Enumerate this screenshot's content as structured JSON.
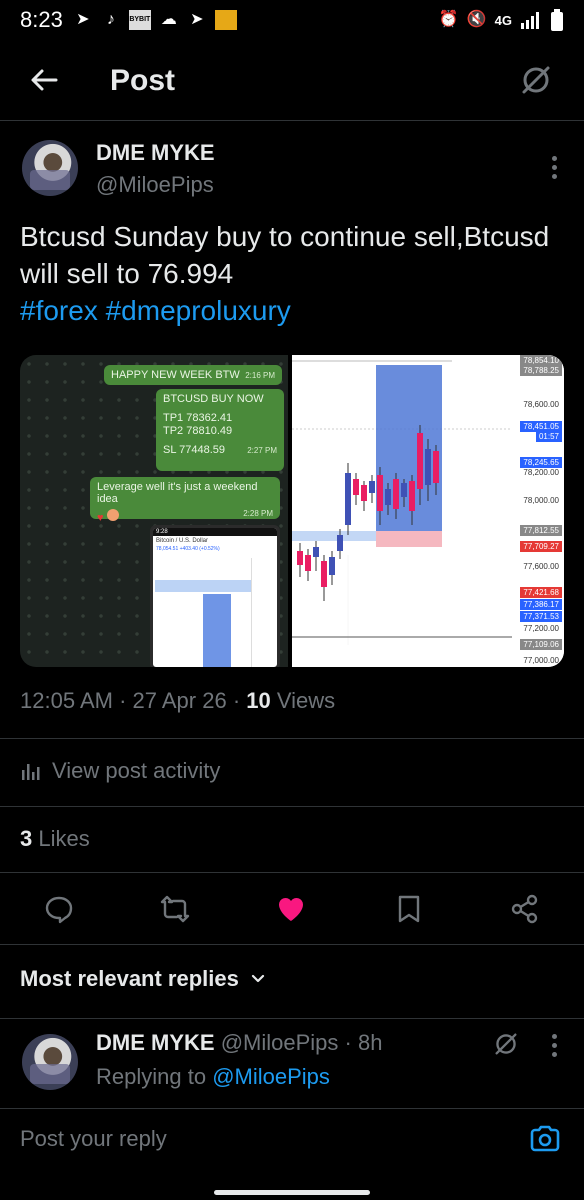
{
  "status_bar": {
    "time": "8:23",
    "icons": [
      "telegram-icon",
      "tiktok-icon",
      "bybit-icon",
      "cloud-icon",
      "telegram-icon",
      "app-icon"
    ],
    "bybit": "BYBIT",
    "network": "4G",
    "right_icons": [
      "alarm-icon",
      "mute-icon",
      "signal-icon",
      "battery-icon"
    ]
  },
  "header": {
    "title": "Post"
  },
  "post": {
    "author_name": "DME MYKE",
    "author_handle": "@MiloePips",
    "text_main": "Btcusd Sunday buy to continue sell,Btcusd will sell to 76.994",
    "hashtag_1": "#forex",
    "hashtag_2": "#dmeproluxury",
    "media": {
      "chat": {
        "msg1": "HAPPY NEW WEEK BTW",
        "msg1_time": "2:16 PM",
        "msg2_title": "BTCUSD BUY NOW",
        "msg2_tp1": "TP1 78362.41",
        "msg2_tp2": "TP2 78810.49",
        "msg2_sl": "SL 77448.59",
        "msg2_time": "2:27 PM",
        "msg3": "Leverage well it's just a weekend idea",
        "msg3_time": "2:28 PM",
        "inner_time": "9:28",
        "inner_title": "Bitcoin / U.S. Dollar",
        "inner_price": "78,054.51 +403.40 (+0.52%)"
      },
      "chart": {
        "labels": [
          "78,854.10",
          "78,788.25",
          "78,600.00",
          "78,451.05",
          "01:57",
          "78,245.65",
          "78,200.00",
          "78,000.00",
          "77,812.55",
          "77,709.27",
          "77,600.00",
          "77,421.68",
          "77,386.17",
          "77,371.53",
          "77,200.00",
          "77,109.06",
          "77,000.00"
        ]
      }
    },
    "time": "12:05 AM",
    "date": "27 Apr 26",
    "views_count": "10",
    "views_label": "Views",
    "activity_label": "View post activity",
    "likes_count": "3",
    "likes_label": "Likes"
  },
  "section": {
    "title": "Most relevant replies"
  },
  "reply": {
    "author_name": "DME MYKE",
    "author_handle": "@MiloePips",
    "age": "8h",
    "replying_prefix": "Replying to",
    "replying_handle": "@MiloePips"
  },
  "composer": {
    "placeholder": "Post your reply"
  },
  "colors": {
    "accent": "#1d9bf0",
    "like": "#f91880",
    "muted": "#71767b",
    "text": "#e7e9ea"
  }
}
